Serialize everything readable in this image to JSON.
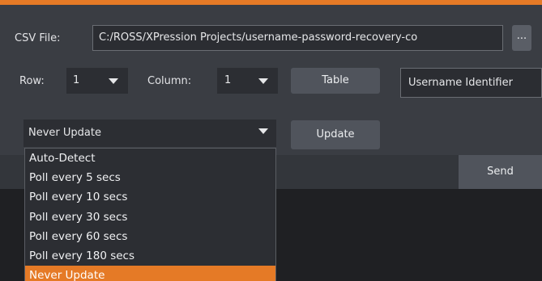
{
  "csv": {
    "label": "CSV File:",
    "path": "C:/ROSS/XPression Projects/username-password-recovery-co",
    "browse_label": "..."
  },
  "row": {
    "label": "Row:",
    "value": "1"
  },
  "column": {
    "label": "Column:",
    "value": "1"
  },
  "table_button": "Table",
  "identifier_field": "Username Identifier",
  "update_mode": {
    "selected": "Never Update",
    "options": [
      "Auto-Detect",
      "Poll every 5 secs",
      "Poll every 10 secs",
      "Poll every 30 secs",
      "Poll every 60 secs",
      "Poll every 180 secs",
      "Never Update"
    ]
  },
  "update_button": "Update",
  "send_button": "Send",
  "colors": {
    "accent": "#e57a26",
    "panel": "#3a3d43",
    "field": "#2b2d32",
    "button": "#50545c"
  }
}
